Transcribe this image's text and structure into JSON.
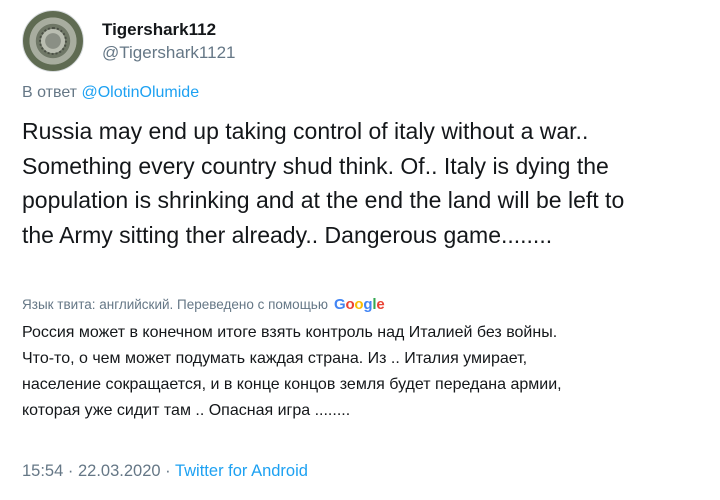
{
  "user": {
    "display_name": "Tigershark112",
    "handle": "@Tigershark1121"
  },
  "reply": {
    "prefix": "В ответ",
    "mention": "@OlotinOlumide"
  },
  "tweet_lines": [
    "Russia may end up taking control of italy without a war..",
    "Something every country shud think. Of.. Italy is dying the",
    "population is shrinking and at the end the land will be left to",
    "the Army sitting ther already.. Dangerous game........"
  ],
  "translation": {
    "label": "Язык твита: английский. Переведено с помощью",
    "google_logo": "Google",
    "lines": [
      "Россия может в конечном итоге взять контроль над Италией без войны.",
      "Что-то, о чем может подумать каждая страна. Из .. Италия умирает,",
      "население сокращается, и в конце концов земля будет передана армии,",
      "которая уже сидит там .. Опасная игра ........"
    ]
  },
  "meta": {
    "time": "15:54",
    "separator": "·",
    "date": "22.03.2020",
    "source": "Twitter for Android"
  }
}
